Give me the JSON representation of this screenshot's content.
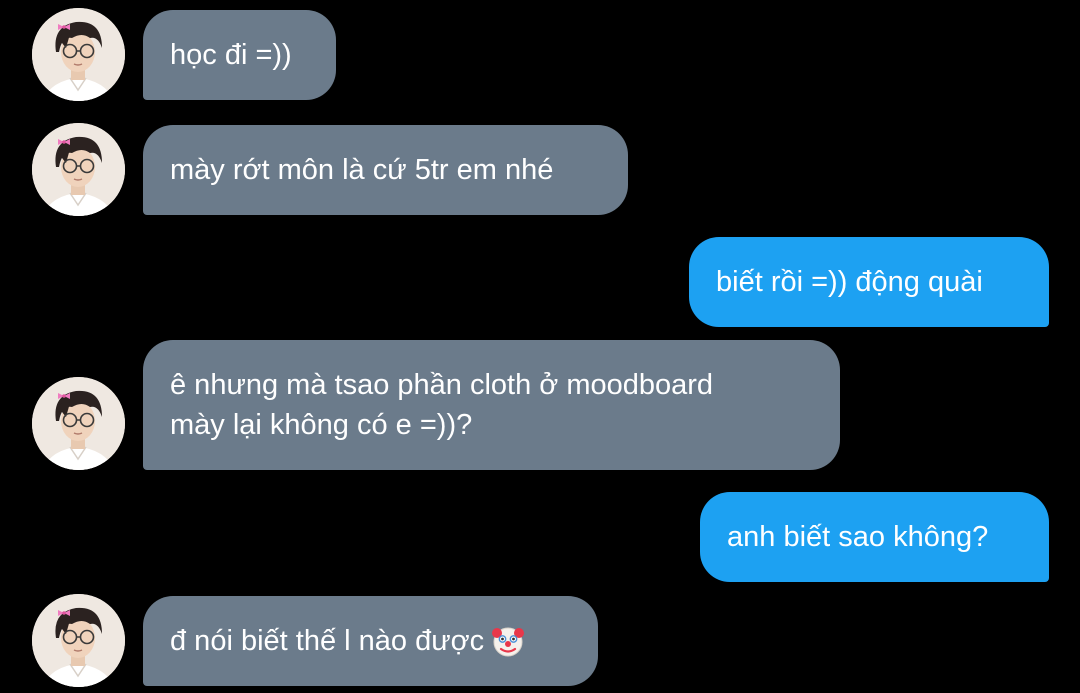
{
  "messages": [
    {
      "direction": "received",
      "text": "học đi =))"
    },
    {
      "direction": "received",
      "text": "mày rớt môn là cứ 5tr em nhé"
    },
    {
      "direction": "sent",
      "text": "biết rồi =)) động quài"
    },
    {
      "direction": "received",
      "text": "ê nhưng mà tsao phần cloth ở moodboard\nmày lại không có e =))?"
    },
    {
      "direction": "sent",
      "text": "anh biết sao không?"
    },
    {
      "direction": "received",
      "text": "đ nói biết thế l nào được",
      "emoji": "clown-face-icon"
    }
  ],
  "colors": {
    "background": "#000000",
    "received_bubble": "#6b7b8b",
    "sent_bubble": "#1da1f2",
    "text": "#ffffff"
  }
}
